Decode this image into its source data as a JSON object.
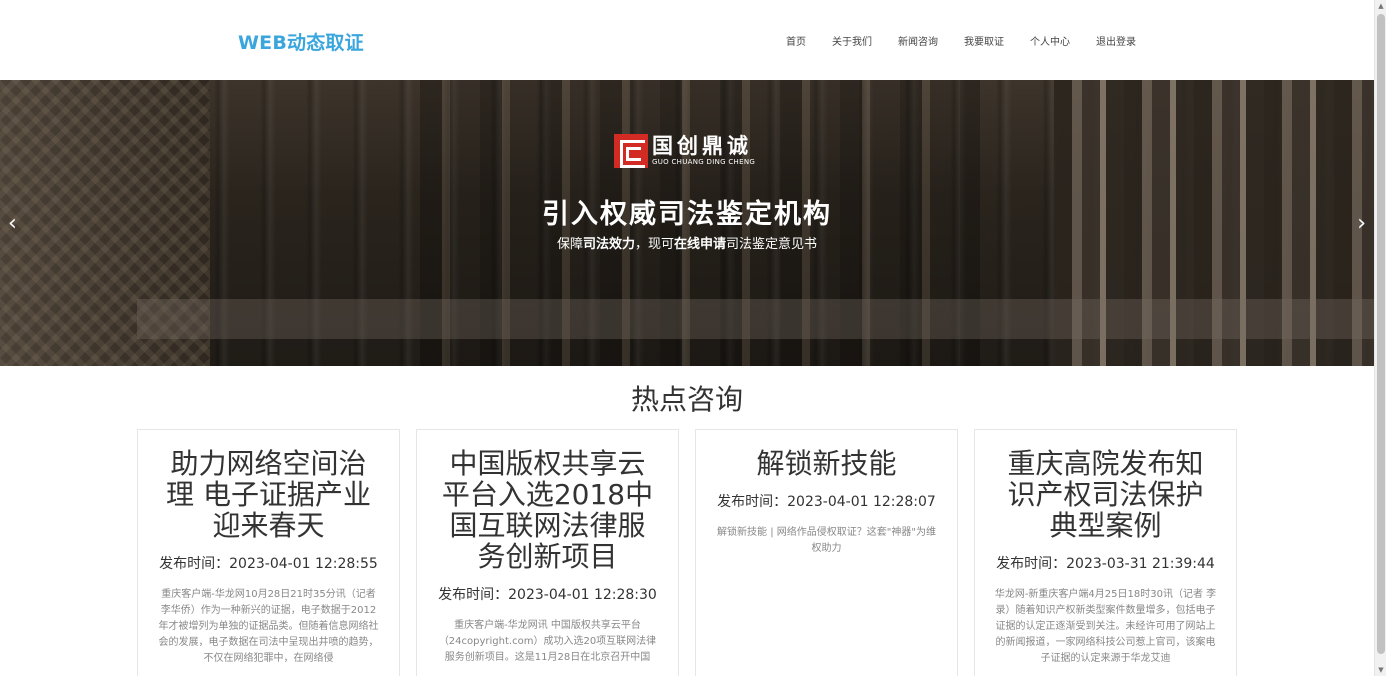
{
  "brand": "WEB动态取证",
  "nav": [
    "首页",
    "关于我们",
    "新闻咨询",
    "我要取证",
    "个人中心",
    "退出登录"
  ],
  "banner": {
    "logo_cn": "国创鼎诚",
    "logo_en": "GUO CHUANG DING CHENG",
    "title": "引入权威司法鉴定机构",
    "sub_1": "保障",
    "sub_2": "司法效力",
    "sub_3": "，现可",
    "sub_4": "在线申请",
    "sub_5": "司法鉴定意见书",
    "arrow_left": "‹",
    "arrow_right": "›"
  },
  "section_title": "热点咨询",
  "date_label": "发布时间：",
  "cards": [
    {
      "title": "助力网络空间治理 电子证据产业迎来春天",
      "date": "2023-04-01 12:28:55",
      "body": "重庆客户端-华龙网10月28日21时35分讯（记者 李华侨）作为一种新兴的证据，电子数据于2012年才被增列为单独的证据品类。但随着信息网络社会的发展，电子数据在司法中呈现出井喷的趋势，不仅在网络犯罪中，在网络侵"
    },
    {
      "title": "中国版权共享云平台入选2018中国互联网法律服务创新项目",
      "date": "2023-04-01 12:28:30",
      "body": "重庆客户端-华龙网讯 中国版权共享云平台（24copyright.com）成功入选20项互联网法律服务创新项目。这是11月28日在北京召开中国"
    },
    {
      "title": "解锁新技能",
      "date": "2023-04-01 12:28:07",
      "body": "解锁新技能 | 网络作品侵权取证？这套\"神器\"为维权助力"
    },
    {
      "title": "重庆高院发布知识产权司法保护典型案例",
      "date": "2023-03-31 21:39:44",
      "body": "华龙网-新重庆客户端4月25日18时30讯（记者 李录）随着知识产权新类型案件数量增多，包括电子证据的认定正逐渐受到关注。未经许可用了网站上的新闻报道，一家网络科技公司惹上官司，该案电子证据的认定来源于华龙艾迪"
    }
  ]
}
